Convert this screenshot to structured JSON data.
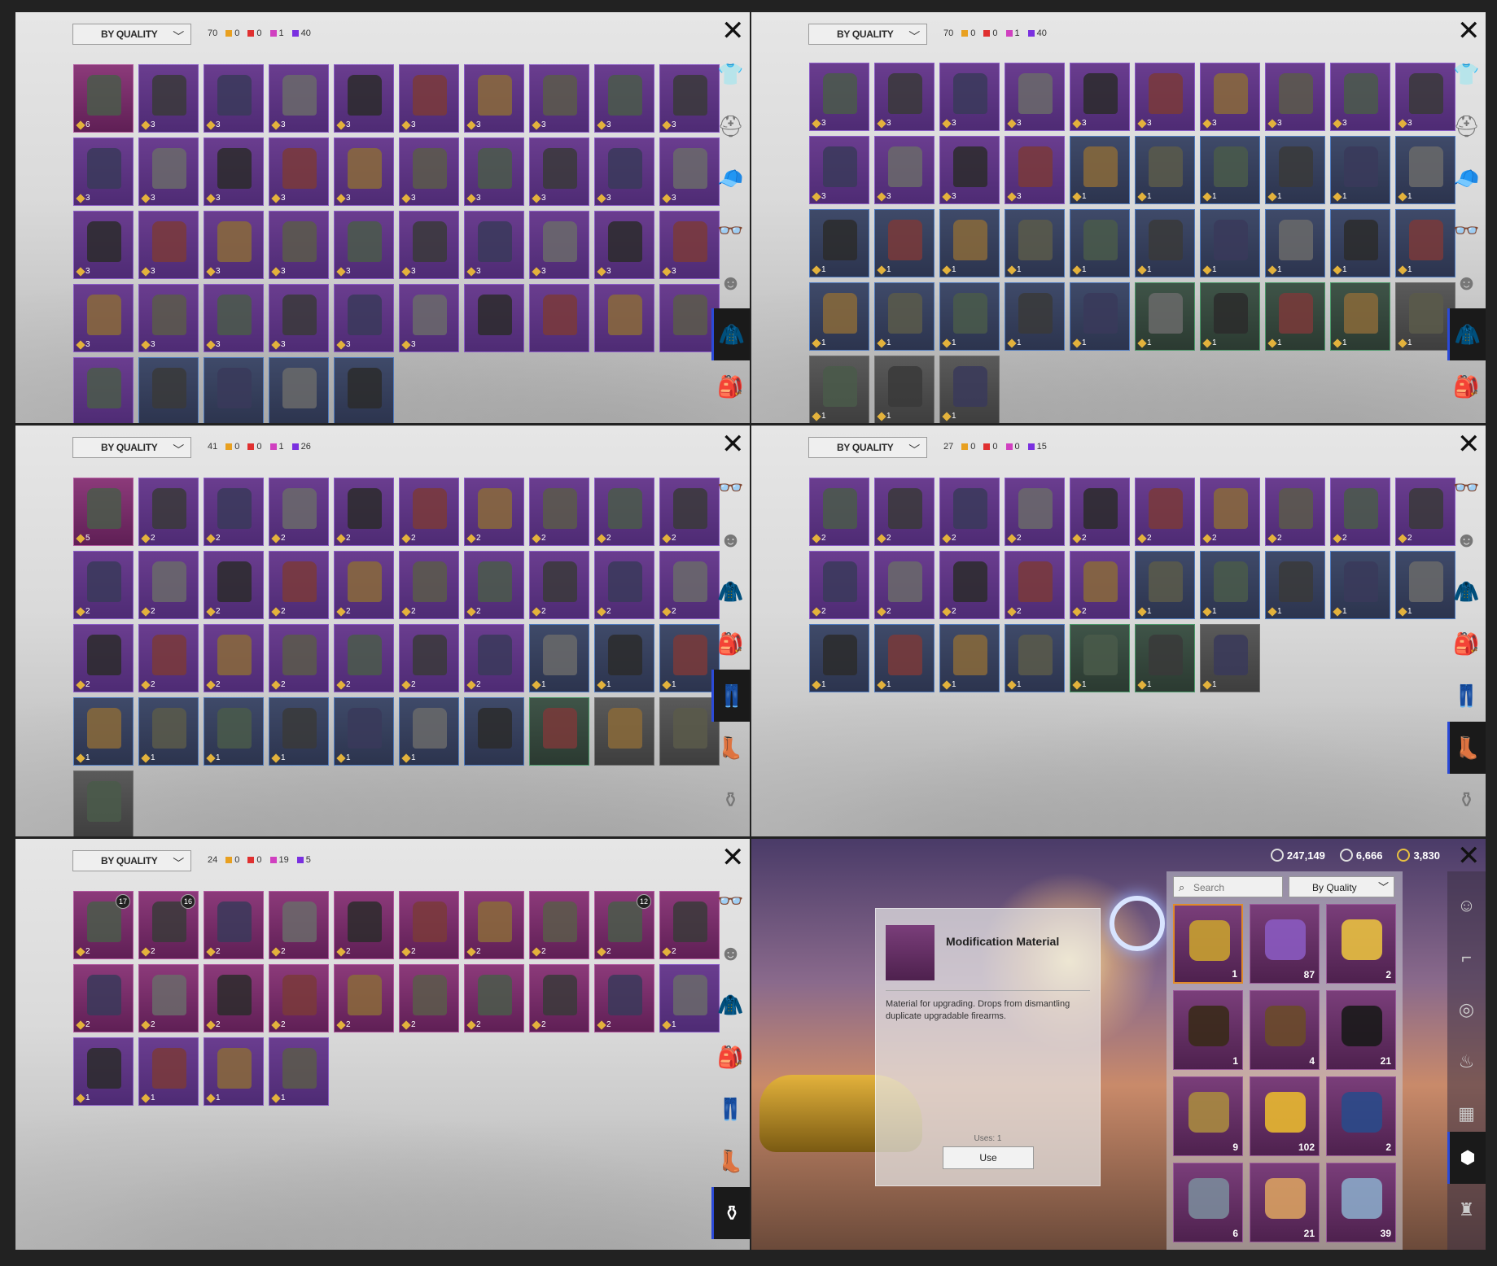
{
  "sort_label": "BY QUALITY",
  "panels": [
    {
      "total": "70",
      "counts": {
        "orange": "0",
        "red": "0",
        "pink": "1",
        "purple": "40"
      }
    },
    {
      "total": "70",
      "counts": {
        "orange": "0",
        "red": "0",
        "pink": "1",
        "purple": "40"
      }
    },
    {
      "total": "41",
      "counts": {
        "orange": "0",
        "red": "0",
        "pink": "1",
        "purple": "26"
      }
    },
    {
      "total": "27",
      "counts": {
        "orange": "0",
        "red": "0",
        "pink": "0",
        "purple": "15"
      }
    },
    {
      "total": "24",
      "counts": {
        "orange": "0",
        "red": "0",
        "pink": "19",
        "purple": "5"
      }
    }
  ],
  "colors": {
    "orange": "#e8a020",
    "red": "#e03030",
    "pink": "#d040c0",
    "purple": "#7a30e0",
    "accent": "#2b4ad8"
  },
  "panel1_items": [
    "6",
    "3",
    "3",
    "3",
    "3",
    "3",
    "3",
    "3",
    "3",
    "3",
    "3",
    "3",
    "3",
    "3",
    "3",
    "3",
    "3",
    "3",
    "3",
    "3",
    "3",
    "3",
    "3",
    "3",
    "3",
    "3",
    "3",
    "3",
    "3",
    "3",
    "3",
    "3",
    "3",
    "3",
    "3",
    "3",
    "",
    "",
    "",
    "",
    "",
    "",
    "",
    "",
    ""
  ],
  "panel2_items": [
    "3",
    "3",
    "3",
    "3",
    "3",
    "3",
    "3",
    "3",
    "3",
    "3",
    "3",
    "3",
    "3",
    "3",
    "1",
    "1",
    "1",
    "1",
    "1",
    "1",
    "1",
    "1",
    "1",
    "1",
    "1",
    "1",
    "1",
    "1",
    "1",
    "1",
    "1",
    "1",
    "1",
    "1",
    "1",
    "1",
    "1",
    "1",
    "1",
    "1",
    "1",
    "1",
    "1"
  ],
  "panel3_items": [
    "5",
    "2",
    "2",
    "2",
    "2",
    "2",
    "2",
    "2",
    "2",
    "2",
    "2",
    "2",
    "2",
    "2",
    "2",
    "2",
    "2",
    "2",
    "2",
    "2",
    "2",
    "2",
    "2",
    "2",
    "2",
    "2",
    "2",
    "1",
    "1",
    "1",
    "1",
    "1",
    "1",
    "1",
    "1",
    "1",
    "",
    "",
    "",
    "",
    ""
  ],
  "panel4_items": [
    "2",
    "2",
    "2",
    "2",
    "2",
    "2",
    "2",
    "2",
    "2",
    "2",
    "2",
    "2",
    "2",
    "2",
    "2",
    "1",
    "1",
    "1",
    "1",
    "1",
    "1",
    "1",
    "1",
    "1",
    "1",
    "1",
    "1"
  ],
  "panel5_items": [
    "2",
    "2",
    "2",
    "2",
    "2",
    "2",
    "2",
    "2",
    "2",
    "2",
    "2",
    "2",
    "2",
    "2",
    "2",
    "2",
    "2",
    "2",
    "2",
    "1",
    "1",
    "1",
    "1",
    "1"
  ],
  "panel5_levels": [
    "17",
    "16",
    "",
    "",
    "",
    "",
    "",
    "",
    "12"
  ],
  "inventory": {
    "currency": [
      "247,149",
      "6,666",
      "3,830"
    ],
    "search_placeholder": "Search",
    "sort": "By Quality",
    "item_title": "Modification Material",
    "item_desc": "Material for upgrading. Drops from dismantling duplicate upgradable firearms.",
    "uses": "Uses: 1",
    "use_button": "Use",
    "quantities": [
      "1",
      "87",
      "2",
      "1",
      "4",
      "21",
      "9",
      "102",
      "2",
      "6",
      "21",
      "39"
    ]
  }
}
